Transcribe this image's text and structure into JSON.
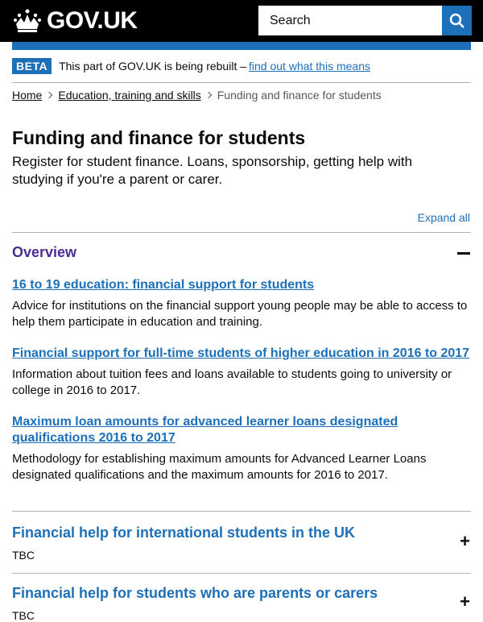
{
  "header": {
    "logo_text": "GOV.UK",
    "search_placeholder": "Search"
  },
  "phase_banner": {
    "tag": "BETA",
    "text": "This part of GOV.UK is being rebuilt –",
    "link": "find out what this means"
  },
  "breadcrumbs": {
    "items": [
      "Home",
      "Education, training and skills"
    ],
    "current": "Funding and finance for students"
  },
  "page": {
    "title": "Funding and finance for students",
    "lead": "Register for student finance. Loans, sponsorship, getting help with studying if you're a parent or carer.",
    "expand_all": "Expand all"
  },
  "sections": [
    {
      "title": "Overview",
      "expanded": true,
      "items": [
        {
          "link": "16 to 19 education: financial support for students",
          "desc": "Advice for institutions on the financial support young people may be able to access to help them participate in education and training."
        },
        {
          "link": "Financial support for full-time students of higher education in 2016 to 2017",
          "desc": "Information about tuition fees and loans available to students going to university or college in 2016 to 2017."
        },
        {
          "link": "Maximum loan amounts for advanced learner loans designated qualifications 2016 to 2017",
          "desc": "Methodology for establishing maximum amounts for Advanced Learner Loans designated qualifications and the maximum amounts for 2016 to 2017."
        }
      ]
    },
    {
      "title": "Financial help for international students in the UK",
      "summary": "TBC",
      "toggle": "+"
    },
    {
      "title": "Financial help for students who are parents or carers",
      "summary": "TBC",
      "toggle": "+"
    }
  ],
  "colors": {
    "link": "#1d70b8",
    "overview_title": "#4c2c92",
    "header_bg": "#000000"
  }
}
